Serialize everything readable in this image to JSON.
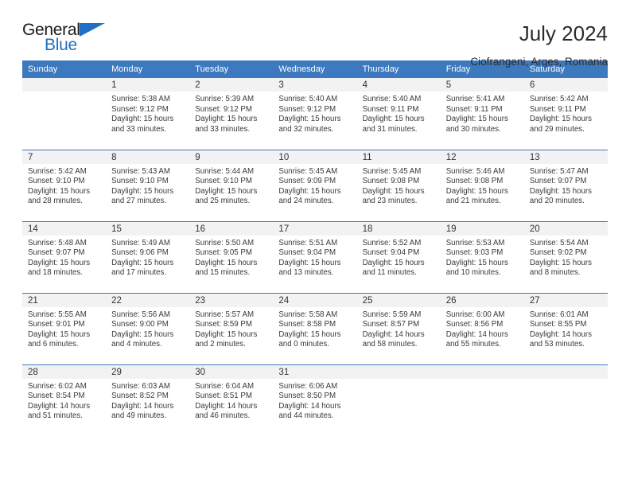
{
  "brand": {
    "name_top": "General",
    "name_bottom": "Blue",
    "accent_color": "#1f6fc4"
  },
  "header": {
    "title": "July 2024",
    "subtitle": "Ciofrangeni, Arges, Romania"
  },
  "theme": {
    "header_bar_color": "#3d79be",
    "daynum_background": "#f2f2f2",
    "text_color": "#333333"
  },
  "calendar": {
    "weekday_headers": [
      "Sunday",
      "Monday",
      "Tuesday",
      "Wednesday",
      "Thursday",
      "Friday",
      "Saturday"
    ],
    "weeks": [
      [
        {
          "day": "",
          "blank": true,
          "sunrise": "",
          "sunset": "",
          "daylight1": "",
          "daylight2": ""
        },
        {
          "day": "1",
          "sunrise": "Sunrise: 5:38 AM",
          "sunset": "Sunset: 9:12 PM",
          "daylight1": "Daylight: 15 hours",
          "daylight2": "and 33 minutes."
        },
        {
          "day": "2",
          "sunrise": "Sunrise: 5:39 AM",
          "sunset": "Sunset: 9:12 PM",
          "daylight1": "Daylight: 15 hours",
          "daylight2": "and 33 minutes."
        },
        {
          "day": "3",
          "sunrise": "Sunrise: 5:40 AM",
          "sunset": "Sunset: 9:12 PM",
          "daylight1": "Daylight: 15 hours",
          "daylight2": "and 32 minutes."
        },
        {
          "day": "4",
          "sunrise": "Sunrise: 5:40 AM",
          "sunset": "Sunset: 9:11 PM",
          "daylight1": "Daylight: 15 hours",
          "daylight2": "and 31 minutes."
        },
        {
          "day": "5",
          "sunrise": "Sunrise: 5:41 AM",
          "sunset": "Sunset: 9:11 PM",
          "daylight1": "Daylight: 15 hours",
          "daylight2": "and 30 minutes."
        },
        {
          "day": "6",
          "sunrise": "Sunrise: 5:42 AM",
          "sunset": "Sunset: 9:11 PM",
          "daylight1": "Daylight: 15 hours",
          "daylight2": "and 29 minutes."
        }
      ],
      [
        {
          "day": "7",
          "sunrise": "Sunrise: 5:42 AM",
          "sunset": "Sunset: 9:10 PM",
          "daylight1": "Daylight: 15 hours",
          "daylight2": "and 28 minutes."
        },
        {
          "day": "8",
          "sunrise": "Sunrise: 5:43 AM",
          "sunset": "Sunset: 9:10 PM",
          "daylight1": "Daylight: 15 hours",
          "daylight2": "and 27 minutes."
        },
        {
          "day": "9",
          "sunrise": "Sunrise: 5:44 AM",
          "sunset": "Sunset: 9:10 PM",
          "daylight1": "Daylight: 15 hours",
          "daylight2": "and 25 minutes."
        },
        {
          "day": "10",
          "sunrise": "Sunrise: 5:45 AM",
          "sunset": "Sunset: 9:09 PM",
          "daylight1": "Daylight: 15 hours",
          "daylight2": "and 24 minutes."
        },
        {
          "day": "11",
          "sunrise": "Sunrise: 5:45 AM",
          "sunset": "Sunset: 9:08 PM",
          "daylight1": "Daylight: 15 hours",
          "daylight2": "and 23 minutes."
        },
        {
          "day": "12",
          "sunrise": "Sunrise: 5:46 AM",
          "sunset": "Sunset: 9:08 PM",
          "daylight1": "Daylight: 15 hours",
          "daylight2": "and 21 minutes."
        },
        {
          "day": "13",
          "sunrise": "Sunrise: 5:47 AM",
          "sunset": "Sunset: 9:07 PM",
          "daylight1": "Daylight: 15 hours",
          "daylight2": "and 20 minutes."
        }
      ],
      [
        {
          "day": "14",
          "sunrise": "Sunrise: 5:48 AM",
          "sunset": "Sunset: 9:07 PM",
          "daylight1": "Daylight: 15 hours",
          "daylight2": "and 18 minutes."
        },
        {
          "day": "15",
          "sunrise": "Sunrise: 5:49 AM",
          "sunset": "Sunset: 9:06 PM",
          "daylight1": "Daylight: 15 hours",
          "daylight2": "and 17 minutes."
        },
        {
          "day": "16",
          "sunrise": "Sunrise: 5:50 AM",
          "sunset": "Sunset: 9:05 PM",
          "daylight1": "Daylight: 15 hours",
          "daylight2": "and 15 minutes."
        },
        {
          "day": "17",
          "sunrise": "Sunrise: 5:51 AM",
          "sunset": "Sunset: 9:04 PM",
          "daylight1": "Daylight: 15 hours",
          "daylight2": "and 13 minutes."
        },
        {
          "day": "18",
          "sunrise": "Sunrise: 5:52 AM",
          "sunset": "Sunset: 9:04 PM",
          "daylight1": "Daylight: 15 hours",
          "daylight2": "and 11 minutes."
        },
        {
          "day": "19",
          "sunrise": "Sunrise: 5:53 AM",
          "sunset": "Sunset: 9:03 PM",
          "daylight1": "Daylight: 15 hours",
          "daylight2": "and 10 minutes."
        },
        {
          "day": "20",
          "sunrise": "Sunrise: 5:54 AM",
          "sunset": "Sunset: 9:02 PM",
          "daylight1": "Daylight: 15 hours",
          "daylight2": "and 8 minutes."
        }
      ],
      [
        {
          "day": "21",
          "sunrise": "Sunrise: 5:55 AM",
          "sunset": "Sunset: 9:01 PM",
          "daylight1": "Daylight: 15 hours",
          "daylight2": "and 6 minutes."
        },
        {
          "day": "22",
          "sunrise": "Sunrise: 5:56 AM",
          "sunset": "Sunset: 9:00 PM",
          "daylight1": "Daylight: 15 hours",
          "daylight2": "and 4 minutes."
        },
        {
          "day": "23",
          "sunrise": "Sunrise: 5:57 AM",
          "sunset": "Sunset: 8:59 PM",
          "daylight1": "Daylight: 15 hours",
          "daylight2": "and 2 minutes."
        },
        {
          "day": "24",
          "sunrise": "Sunrise: 5:58 AM",
          "sunset": "Sunset: 8:58 PM",
          "daylight1": "Daylight: 15 hours",
          "daylight2": "and 0 minutes."
        },
        {
          "day": "25",
          "sunrise": "Sunrise: 5:59 AM",
          "sunset": "Sunset: 8:57 PM",
          "daylight1": "Daylight: 14 hours",
          "daylight2": "and 58 minutes."
        },
        {
          "day": "26",
          "sunrise": "Sunrise: 6:00 AM",
          "sunset": "Sunset: 8:56 PM",
          "daylight1": "Daylight: 14 hours",
          "daylight2": "and 55 minutes."
        },
        {
          "day": "27",
          "sunrise": "Sunrise: 6:01 AM",
          "sunset": "Sunset: 8:55 PM",
          "daylight1": "Daylight: 14 hours",
          "daylight2": "and 53 minutes."
        }
      ],
      [
        {
          "day": "28",
          "sunrise": "Sunrise: 6:02 AM",
          "sunset": "Sunset: 8:54 PM",
          "daylight1": "Daylight: 14 hours",
          "daylight2": "and 51 minutes."
        },
        {
          "day": "29",
          "sunrise": "Sunrise: 6:03 AM",
          "sunset": "Sunset: 8:52 PM",
          "daylight1": "Daylight: 14 hours",
          "daylight2": "and 49 minutes."
        },
        {
          "day": "30",
          "sunrise": "Sunrise: 6:04 AM",
          "sunset": "Sunset: 8:51 PM",
          "daylight1": "Daylight: 14 hours",
          "daylight2": "and 46 minutes."
        },
        {
          "day": "31",
          "sunrise": "Sunrise: 6:06 AM",
          "sunset": "Sunset: 8:50 PM",
          "daylight1": "Daylight: 14 hours",
          "daylight2": "and 44 minutes."
        },
        {
          "day": "",
          "blank": true,
          "sunrise": "",
          "sunset": "",
          "daylight1": "",
          "daylight2": ""
        },
        {
          "day": "",
          "blank": true,
          "sunrise": "",
          "sunset": "",
          "daylight1": "",
          "daylight2": ""
        },
        {
          "day": "",
          "blank": true,
          "sunrise": "",
          "sunset": "",
          "daylight1": "",
          "daylight2": ""
        }
      ]
    ]
  }
}
